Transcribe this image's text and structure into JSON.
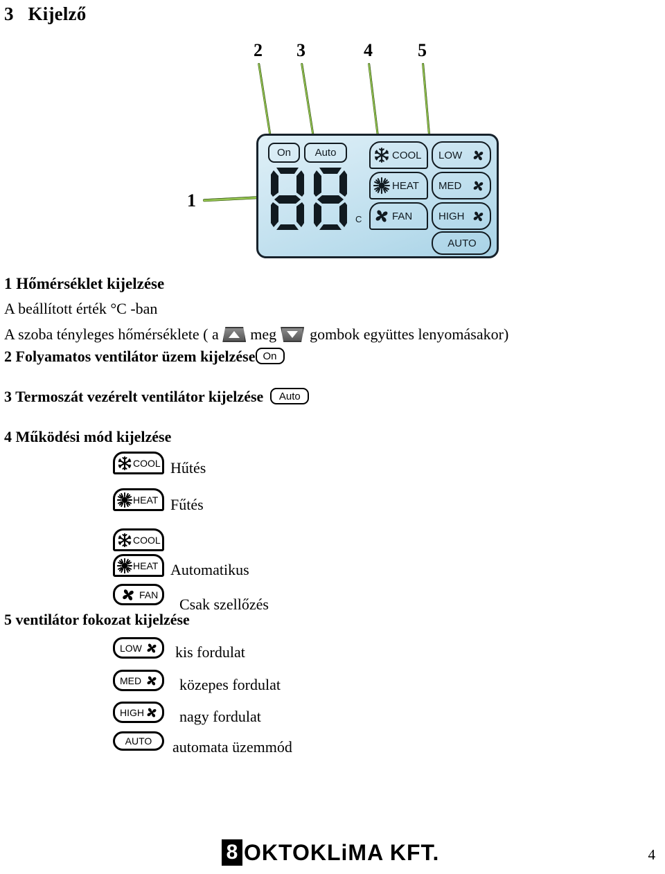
{
  "document": {
    "title": "3   Kijelző",
    "page_number": "4"
  },
  "diagram": {
    "callouts": [
      {
        "id": "1",
        "label": "1"
      },
      {
        "id": "2",
        "label": "2"
      },
      {
        "id": "3",
        "label": "3"
      },
      {
        "id": "4",
        "label": "4"
      },
      {
        "id": "5",
        "label": "5"
      }
    ],
    "lcd": {
      "on_badge": "On",
      "auto_badge": "Auto",
      "digits": "88",
      "unit": "C",
      "mode_cells": [
        {
          "icon": "snowflake-icon",
          "label": "COOL"
        },
        {
          "icon": "sun-icon",
          "label": "HEAT"
        },
        {
          "icon": "fan-icon",
          "label": "FAN"
        }
      ],
      "speed_cells": [
        {
          "label": "LOW",
          "icon": "fan-icon"
        },
        {
          "label": "MED",
          "icon": "fan-icon"
        },
        {
          "label": "HIGH",
          "icon": "fan-icon"
        },
        {
          "label": "AUTO",
          "icon": ""
        }
      ]
    }
  },
  "legend": {
    "item1": {
      "heading": "1 Hőmérséklet kijelzése",
      "line1": "A beállított érték °C -ban",
      "line2_a": "A szoba tényleges hőmérséklete ( a ",
      "line2_b": "meg",
      "line2_c": "gombok együttes lenyomásakor)"
    },
    "item2": {
      "heading": "2 Folyamatos ventilátor üzem kijelzése",
      "badge": "On"
    },
    "item3": {
      "heading": "3 Termoszát vezérelt ventilátor kijelzése",
      "badge": "Auto"
    },
    "item4": {
      "heading": "4 Működési mód kijelzése",
      "rows": [
        {
          "icon": "snowflake-icon",
          "icon_label": "COOL",
          "text": "Hűtés"
        },
        {
          "icon": "sun-icon",
          "icon_label": "HEAT",
          "text": "Fűtés"
        },
        {
          "icon": "snowflake-icon",
          "icon_label": "COOL",
          "text": ""
        },
        {
          "icon": "sun-icon",
          "icon_label": "HEAT",
          "text": "Automatikus"
        },
        {
          "icon": "fan-icon",
          "icon_label": "FAN",
          "text": "Csak szellőzés"
        }
      ]
    },
    "item5": {
      "heading": "5 ventilátor fokozat kijelzése",
      "rows": [
        {
          "icon_label": "LOW",
          "icon": "fan-icon",
          "text": "kis fordulat"
        },
        {
          "icon_label": "MED",
          "icon": "fan-icon",
          "text": "közepes fordulat"
        },
        {
          "icon_label": "HIGH",
          "icon": "fan-icon",
          "text": "nagy fordulat"
        },
        {
          "icon_label": "AUTO",
          "icon": "",
          "text": "automata üzemmód"
        }
      ]
    }
  },
  "footer": {
    "logo_mark": "8",
    "logo_text": "OKTOKLiMA KFT."
  },
  "colors": {
    "leader_line": "#8dc63f",
    "lcd_background": "#cde6f2",
    "lcd_border": "#17222b",
    "text": "#000000"
  }
}
